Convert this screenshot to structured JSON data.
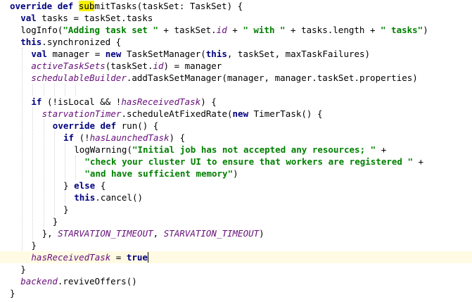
{
  "editor": {
    "current_line": 21,
    "lines": [
      {
        "indent": 0,
        "tokens": [
          {
            "t": "override def ",
            "c": "kw"
          },
          {
            "t": "sub",
            "c": "mark"
          },
          {
            "t": "mitTasks(taskSet: TaskSet) {",
            "c": "plain"
          }
        ]
      },
      {
        "indent": 2,
        "tokens": [
          {
            "t": "val ",
            "c": "kw"
          },
          {
            "t": "tasks = taskSet.tasks",
            "c": "plain"
          }
        ]
      },
      {
        "indent": 2,
        "tokens": [
          {
            "t": "logInfo(",
            "c": "plain"
          },
          {
            "t": "\"Adding task set \"",
            "c": "str"
          },
          {
            "t": " + taskSet.",
            "c": "plain"
          },
          {
            "t": "id",
            "c": "ital"
          },
          {
            "t": " + ",
            "c": "plain"
          },
          {
            "t": "\" with \"",
            "c": "str"
          },
          {
            "t": " + tasks.length + ",
            "c": "plain"
          },
          {
            "t": "\" tasks\"",
            "c": "str"
          },
          {
            "t": ")",
            "c": "plain"
          }
        ]
      },
      {
        "indent": 2,
        "tokens": [
          {
            "t": "this",
            "c": "kw"
          },
          {
            "t": ".synchronized {",
            "c": "plain"
          }
        ]
      },
      {
        "indent": 4,
        "tokens": [
          {
            "t": "val ",
            "c": "kw"
          },
          {
            "t": "manager = ",
            "c": "plain"
          },
          {
            "t": "new ",
            "c": "kw"
          },
          {
            "t": "TaskSetManager(",
            "c": "plain"
          },
          {
            "t": "this",
            "c": "kw"
          },
          {
            "t": ", taskSet, maxTaskFailures)",
            "c": "plain"
          }
        ]
      },
      {
        "indent": 4,
        "tokens": [
          {
            "t": "activeTaskSets",
            "c": "ital"
          },
          {
            "t": "(taskSet.",
            "c": "plain"
          },
          {
            "t": "id",
            "c": "ital"
          },
          {
            "t": ") = manager",
            "c": "plain"
          }
        ]
      },
      {
        "indent": 4,
        "tokens": [
          {
            "t": "schedulableBuilder",
            "c": "ital"
          },
          {
            "t": ".addTaskSetManager(manager, manager.taskSet.properties)",
            "c": "plain"
          }
        ]
      },
      {
        "indent": 0,
        "tokens": []
      },
      {
        "indent": 4,
        "tokens": [
          {
            "t": "if ",
            "c": "kw"
          },
          {
            "t": "(!isLocal && !",
            "c": "plain"
          },
          {
            "t": "hasReceivedTask",
            "c": "ital"
          },
          {
            "t": ") {",
            "c": "plain"
          }
        ]
      },
      {
        "indent": 6,
        "tokens": [
          {
            "t": "starvationTimer",
            "c": "ital"
          },
          {
            "t": ".scheduleAtFixedRate(",
            "c": "plain"
          },
          {
            "t": "new ",
            "c": "kw"
          },
          {
            "t": "TimerTask() {",
            "c": "plain"
          }
        ]
      },
      {
        "indent": 8,
        "tokens": [
          {
            "t": "override def ",
            "c": "kw"
          },
          {
            "t": "run() {",
            "c": "plain"
          }
        ]
      },
      {
        "indent": 10,
        "tokens": [
          {
            "t": "if ",
            "c": "kw"
          },
          {
            "t": "(!",
            "c": "plain"
          },
          {
            "t": "hasLaunchedTask",
            "c": "ital"
          },
          {
            "t": ") {",
            "c": "plain"
          }
        ]
      },
      {
        "indent": 12,
        "tokens": [
          {
            "t": "logWarning(",
            "c": "plain"
          },
          {
            "t": "\"Initial job has not accepted any resources; \"",
            "c": "str"
          },
          {
            "t": " +",
            "c": "plain"
          }
        ]
      },
      {
        "indent": 14,
        "tokens": [
          {
            "t": "\"check your cluster UI to ensure that workers are registered \"",
            "c": "str"
          },
          {
            "t": " +",
            "c": "plain"
          }
        ]
      },
      {
        "indent": 14,
        "tokens": [
          {
            "t": "\"and have sufficient memory\"",
            "c": "str"
          },
          {
            "t": ")",
            "c": "plain"
          }
        ]
      },
      {
        "indent": 10,
        "tokens": [
          {
            "t": "} ",
            "c": "plain"
          },
          {
            "t": "else ",
            "c": "kw"
          },
          {
            "t": "{",
            "c": "plain"
          }
        ]
      },
      {
        "indent": 12,
        "tokens": [
          {
            "t": "this",
            "c": "kw"
          },
          {
            "t": ".cancel()",
            "c": "plain"
          }
        ]
      },
      {
        "indent": 10,
        "tokens": [
          {
            "t": "}",
            "c": "plain"
          }
        ]
      },
      {
        "indent": 8,
        "tokens": [
          {
            "t": "}",
            "c": "plain"
          }
        ]
      },
      {
        "indent": 6,
        "tokens": [
          {
            "t": "}, ",
            "c": "plain"
          },
          {
            "t": "STARVATION_TIMEOUT",
            "c": "ital"
          },
          {
            "t": ", ",
            "c": "plain"
          },
          {
            "t": "STARVATION_TIMEOUT",
            "c": "ital"
          },
          {
            "t": ")",
            "c": "plain"
          }
        ]
      },
      {
        "indent": 4,
        "tokens": [
          {
            "t": "}",
            "c": "plain"
          }
        ]
      },
      {
        "indent": 4,
        "tokens": [
          {
            "t": "hasReceivedTask",
            "c": "ital"
          },
          {
            "t": " = ",
            "c": "plain"
          },
          {
            "t": "true",
            "c": "kw"
          }
        ]
      },
      {
        "indent": 2,
        "tokens": [
          {
            "t": "}",
            "c": "plain"
          }
        ]
      },
      {
        "indent": 2,
        "tokens": [
          {
            "t": "backend",
            "c": "ital"
          },
          {
            "t": ".reviveOffers()",
            "c": "plain"
          }
        ]
      },
      {
        "indent": 0,
        "tokens": [
          {
            "t": "}",
            "c": "plain"
          }
        ]
      }
    ]
  }
}
